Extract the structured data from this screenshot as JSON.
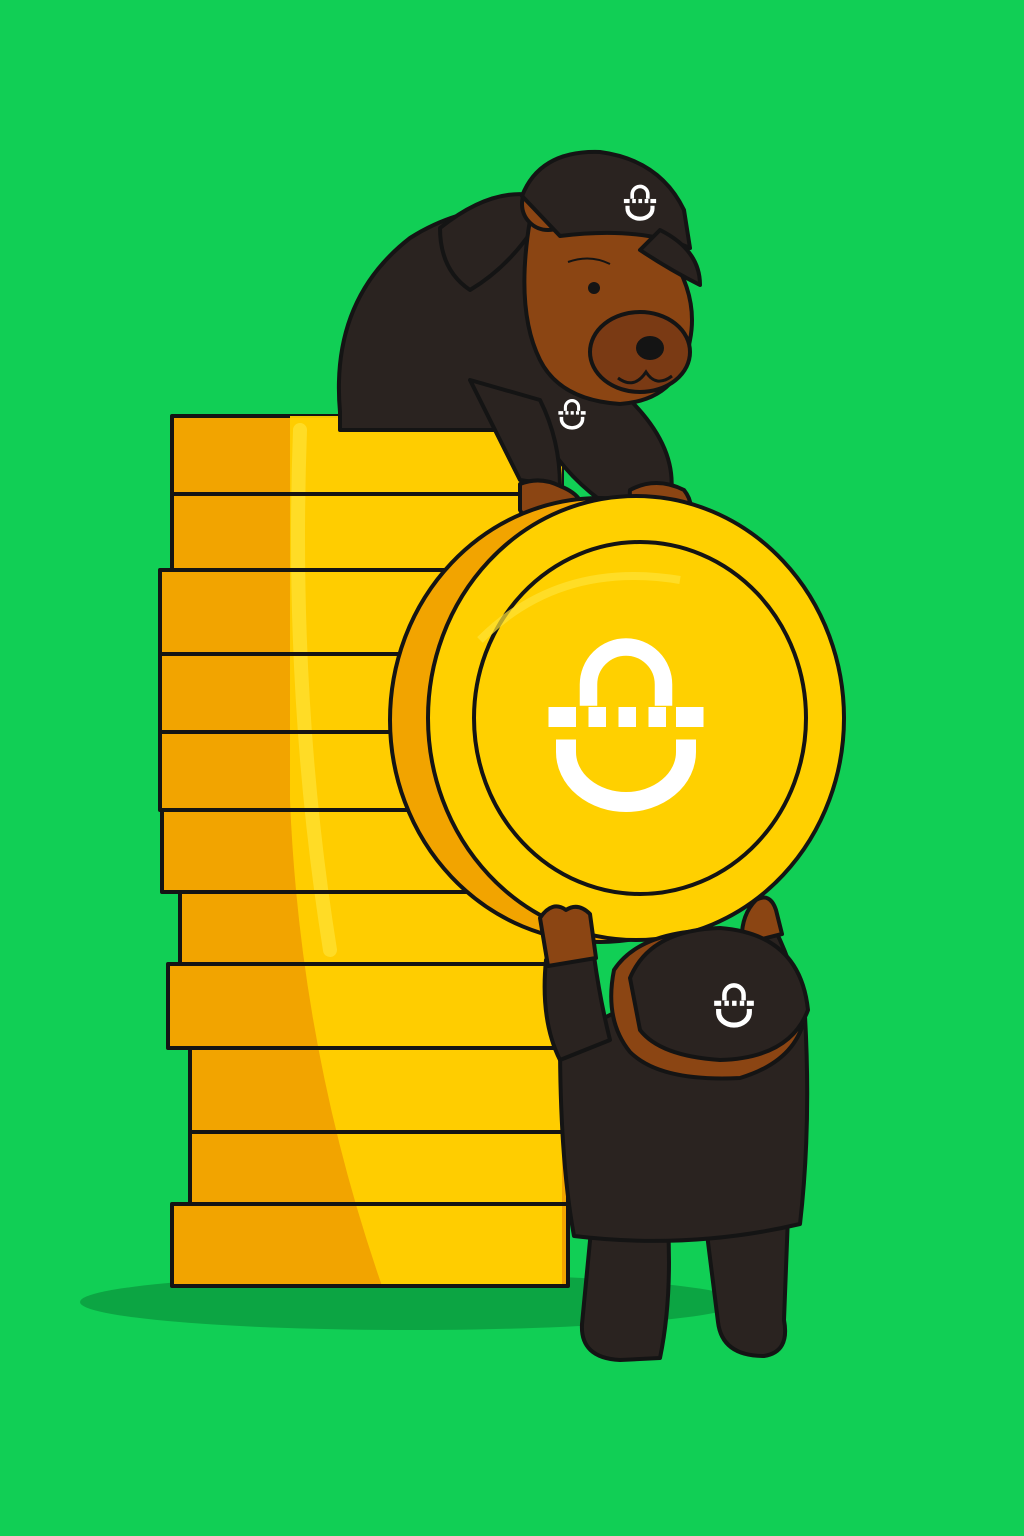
{
  "scene": {
    "description_for_accessibility": "",
    "background_color": "#11CF55",
    "shadow_color": "#0CA543",
    "coin_gold": "#FFD000",
    "coin_side": "#F2A400",
    "coin_highlight": "#FFE236",
    "hoodie_color": "#2A2320",
    "fur_color": "#8B4513",
    "fur_light": "#A0522D",
    "muzzle_color": "#7A3A14",
    "logo_color": "#FFFFFF"
  },
  "elements": {
    "coin_stack_layers": 12,
    "big_coin_logo": "logo-mark",
    "top_bear_cap_logo": "logo-mark",
    "top_bear_hoodie_logo": "logo-mark",
    "bottom_bear_cap_logo": "logo-mark"
  }
}
